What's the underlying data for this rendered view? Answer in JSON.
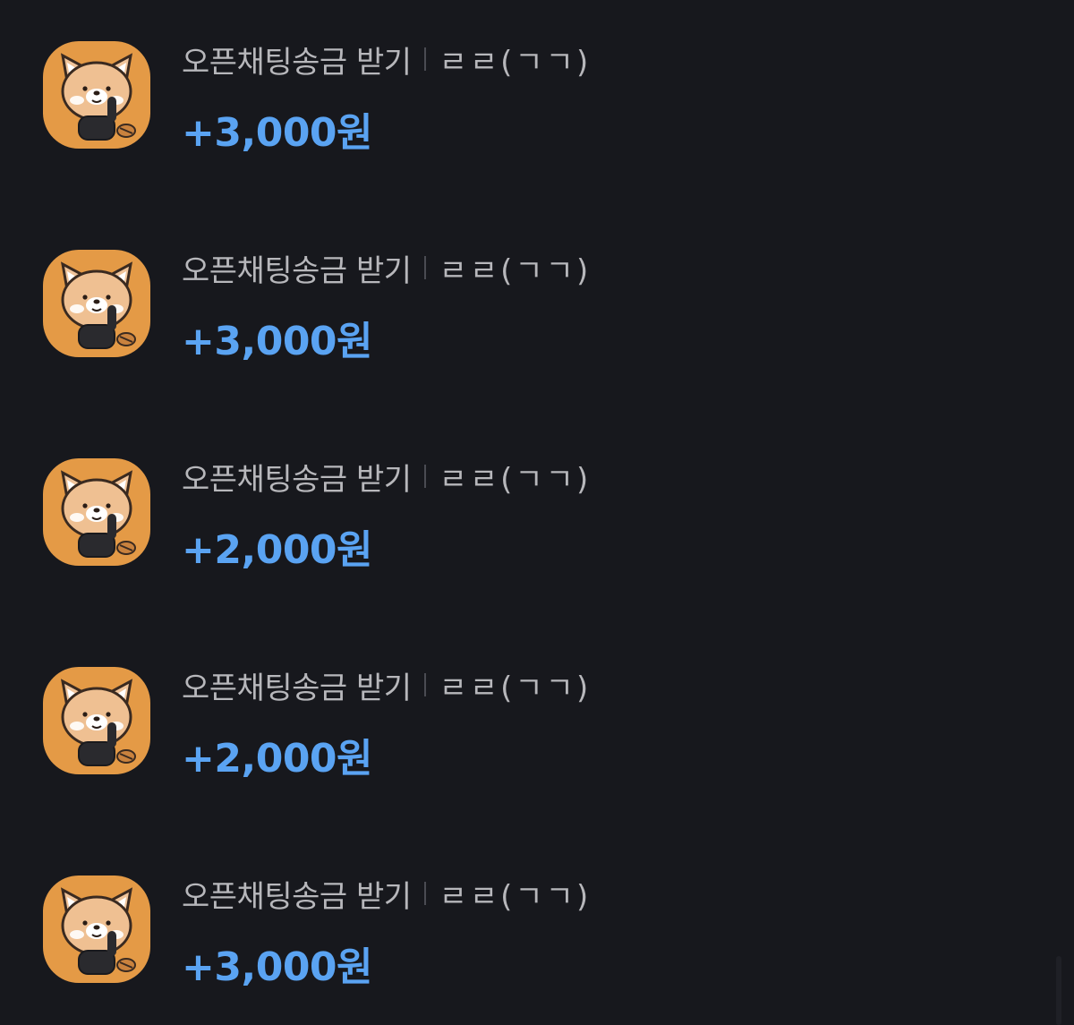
{
  "transactions": [
    {
      "title": "오픈채팅송금 받기",
      "sender": "ㄹㄹ(ㄱㄱ)",
      "amount": "+3,000원"
    },
    {
      "title": "오픈채팅송금 받기",
      "sender": "ㄹㄹ(ㄱㄱ)",
      "amount": "+3,000원"
    },
    {
      "title": "오픈채팅송금 받기",
      "sender": "ㄹㄹ(ㄱㄱ)",
      "amount": "+2,000원"
    },
    {
      "title": "오픈채팅송금 받기",
      "sender": "ㄹㄹ(ㄱㄱ)",
      "amount": "+2,000원"
    },
    {
      "title": "오픈채팅송금 받기",
      "sender": "ㄹㄹ(ㄱㄱ)",
      "amount": "+3,000원"
    }
  ],
  "avatar_icon": "red-panda-character-icon",
  "colors": {
    "background": "#17181d",
    "title_text": "#b7b7bb",
    "amount_text": "#5aa3f2",
    "avatar_bg": "#e49a46"
  }
}
